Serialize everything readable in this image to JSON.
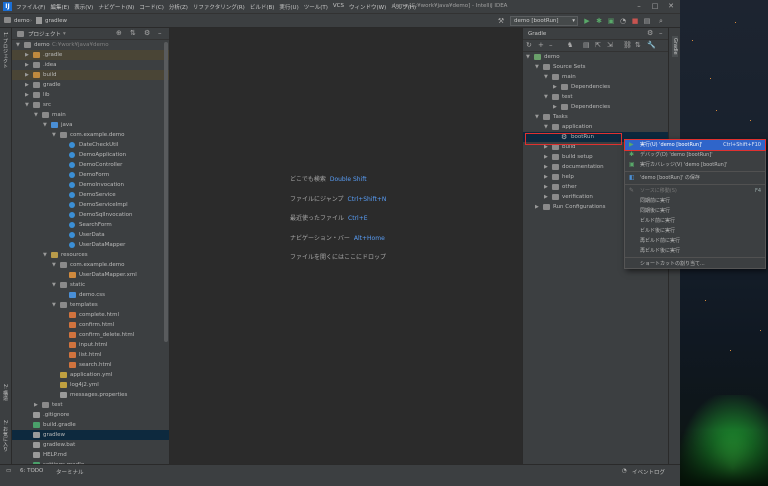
{
  "menubar": {
    "items": [
      "ファイル(F)",
      "編集(E)",
      "表示(V)",
      "ナビゲート(N)",
      "コード(C)",
      "分析(Z)",
      "リファクタリング(R)",
      "ビルド(B)",
      "実行(U)",
      "ツール(T)",
      "VCS",
      "ウィンドウ(W)",
      "ヘルプ(H)"
    ],
    "window_title": "demo [C:¥work¥java¥demo] - IntelliJ IDEA"
  },
  "navbar": {
    "crumbs": [
      "demo",
      "gradlew"
    ],
    "run_config": "demo [bootRun]"
  },
  "left_strip": {
    "tabs": [
      "1: プロジェクト",
      "2: 構造",
      "2: お気に入り"
    ]
  },
  "right_strip": {
    "tabs": [
      "Gradle"
    ]
  },
  "project": {
    "title": "プロジェクト",
    "root_path": "C:¥work¥java¥demo",
    "tree": [
      {
        "label": "demo",
        "depth": 0,
        "type": "folder",
        "open": true
      },
      {
        "label": ".gradle",
        "depth": 1,
        "type": "folder-orange",
        "open": false,
        "hl": true
      },
      {
        "label": ".idea",
        "depth": 1,
        "type": "folder",
        "open": false
      },
      {
        "label": "build",
        "depth": 1,
        "type": "folder-orange",
        "open": false,
        "hl": true
      },
      {
        "label": "gradle",
        "depth": 1,
        "type": "folder",
        "open": false
      },
      {
        "label": "lib",
        "depth": 1,
        "type": "folder",
        "open": false
      },
      {
        "label": "src",
        "depth": 1,
        "type": "folder",
        "open": true
      },
      {
        "label": "main",
        "depth": 2,
        "type": "folder",
        "open": true
      },
      {
        "label": "java",
        "depth": 3,
        "type": "folder-blue",
        "open": true
      },
      {
        "label": "com.example.demo",
        "depth": 4,
        "type": "package",
        "open": true
      },
      {
        "label": "DateCheckUtil",
        "depth": 5,
        "type": "class"
      },
      {
        "label": "DemoApplication",
        "depth": 5,
        "type": "class"
      },
      {
        "label": "DemoController",
        "depth": 5,
        "type": "class"
      },
      {
        "label": "DemoForm",
        "depth": 5,
        "type": "class"
      },
      {
        "label": "DemoInvocation",
        "depth": 5,
        "type": "class"
      },
      {
        "label": "DemoService",
        "depth": 5,
        "type": "class"
      },
      {
        "label": "DemoServiceImpl",
        "depth": 5,
        "type": "class"
      },
      {
        "label": "DemoSqlInvocation",
        "depth": 5,
        "type": "class"
      },
      {
        "label": "SearchForm",
        "depth": 5,
        "type": "class"
      },
      {
        "label": "UserData",
        "depth": 5,
        "type": "class"
      },
      {
        "label": "UserDataMapper",
        "depth": 5,
        "type": "class"
      },
      {
        "label": "resources",
        "depth": 3,
        "type": "folder-res",
        "open": true
      },
      {
        "label": "com.example.demo",
        "depth": 4,
        "type": "folder",
        "open": true
      },
      {
        "label": "UserDataMapper.xml",
        "depth": 5,
        "type": "xml"
      },
      {
        "label": "static",
        "depth": 4,
        "type": "folder",
        "open": true
      },
      {
        "label": "demo.css",
        "depth": 5,
        "type": "css"
      },
      {
        "label": "templates",
        "depth": 4,
        "type": "folder",
        "open": true
      },
      {
        "label": "complete.html",
        "depth": 5,
        "type": "html"
      },
      {
        "label": "confirm.html",
        "depth": 5,
        "type": "html"
      },
      {
        "label": "confirm_delete.html",
        "depth": 5,
        "type": "html"
      },
      {
        "label": "input.html",
        "depth": 5,
        "type": "html"
      },
      {
        "label": "list.html",
        "depth": 5,
        "type": "html"
      },
      {
        "label": "search.html",
        "depth": 5,
        "type": "html"
      },
      {
        "label": "application.yml",
        "depth": 4,
        "type": "yml"
      },
      {
        "label": "log4j2.yml",
        "depth": 4,
        "type": "yml"
      },
      {
        "label": "messages.properties",
        "depth": 4,
        "type": "props"
      },
      {
        "label": "test",
        "depth": 2,
        "type": "folder",
        "open": false
      },
      {
        "label": ".gitignore",
        "depth": 1,
        "type": "file"
      },
      {
        "label": "build.gradle",
        "depth": 1,
        "type": "gradle"
      },
      {
        "label": "gradlew",
        "depth": 1,
        "type": "file",
        "sel": true
      },
      {
        "label": "gradlew.bat",
        "depth": 1,
        "type": "file"
      },
      {
        "label": "HELP.md",
        "depth": 1,
        "type": "file"
      },
      {
        "label": "settings.gradle",
        "depth": 1,
        "type": "gradle"
      }
    ]
  },
  "editor": {
    "hints": [
      {
        "text": "どこでも検索",
        "key": "Double Shift"
      },
      {
        "text": "ファイルにジャンプ",
        "key": "Ctrl+Shift+N"
      },
      {
        "text": "最近使ったファイル",
        "key": "Ctrl+E"
      },
      {
        "text": "ナビゲーション・バー",
        "key": "Alt+Home"
      },
      {
        "text": "ファイルを開くにはここにドロップ",
        "key": ""
      }
    ]
  },
  "gradle": {
    "title": "Gradle",
    "tree": [
      {
        "label": "demo",
        "depth": 0,
        "open": true,
        "icon": "elephant"
      },
      {
        "label": "Source Sets",
        "depth": 1,
        "open": true,
        "icon": "folder"
      },
      {
        "label": "main",
        "depth": 2,
        "open": true,
        "icon": "folder"
      },
      {
        "label": "Dependencies",
        "depth": 3,
        "open": false,
        "icon": "folder"
      },
      {
        "label": "test",
        "depth": 2,
        "open": true,
        "icon": "folder"
      },
      {
        "label": "Dependencies",
        "depth": 3,
        "open": false,
        "icon": "folder"
      },
      {
        "label": "Tasks",
        "depth": 1,
        "open": true,
        "icon": "folder"
      },
      {
        "label": "application",
        "depth": 2,
        "open": true,
        "icon": "folder"
      },
      {
        "label": "bootRun",
        "depth": 3,
        "open": null,
        "icon": "gear",
        "sel": true
      },
      {
        "label": "build",
        "depth": 2,
        "open": false,
        "icon": "folder"
      },
      {
        "label": "build setup",
        "depth": 2,
        "open": false,
        "icon": "folder"
      },
      {
        "label": "documentation",
        "depth": 2,
        "open": false,
        "icon": "folder"
      },
      {
        "label": "help",
        "depth": 2,
        "open": false,
        "icon": "folder"
      },
      {
        "label": "other",
        "depth": 2,
        "open": false,
        "icon": "folder"
      },
      {
        "label": "verification",
        "depth": 2,
        "open": false,
        "icon": "folder"
      },
      {
        "label": "Run Configurations",
        "depth": 1,
        "open": false,
        "icon": "folder"
      }
    ]
  },
  "context_menu": {
    "items": [
      {
        "label": "実行(U) 'demo [bootRun]'",
        "shortcut": "Ctrl+Shift+F10",
        "active": true,
        "icon": "▶",
        "icon_color": "#59a869"
      },
      {
        "label": "デバッグ(D) 'demo [bootRun]'",
        "shortcut": "",
        "icon": "✱",
        "icon_color": "#59a869"
      },
      {
        "label": "実行カバレッジ(V) 'demo [bootRun]'",
        "shortcut": "",
        "icon": "▣",
        "icon_color": "#59a869"
      },
      {
        "sep": true
      },
      {
        "label": "'demo [bootRun]' の保存",
        "shortcut": "",
        "icon": "◧",
        "icon_color": "#4a8fd6"
      },
      {
        "sep": true
      },
      {
        "label": "ソースに移動(S)",
        "shortcut": "F4",
        "disabled": true,
        "icon": "✎",
        "icon_color": "#777"
      },
      {
        "label": "同期前に実行",
        "shortcut": ""
      },
      {
        "label": "同期後に実行",
        "shortcut": ""
      },
      {
        "label": "ビルド前に実行",
        "shortcut": ""
      },
      {
        "label": "ビルド後に実行",
        "shortcut": ""
      },
      {
        "label": "再ビルド前に実行",
        "shortcut": ""
      },
      {
        "label": "再ビルド後に実行",
        "shortcut": ""
      },
      {
        "sep": true
      },
      {
        "label": "ショートカットの割り当て...",
        "shortcut": ""
      }
    ]
  },
  "statusbar": {
    "left_tabs": [
      "6: TODO",
      "ターミナル"
    ],
    "right_label": "イベントログ"
  },
  "colors": {
    "accent": "#2f65ca",
    "highlight_box": "#e0312f",
    "selection": "#0d293e"
  }
}
